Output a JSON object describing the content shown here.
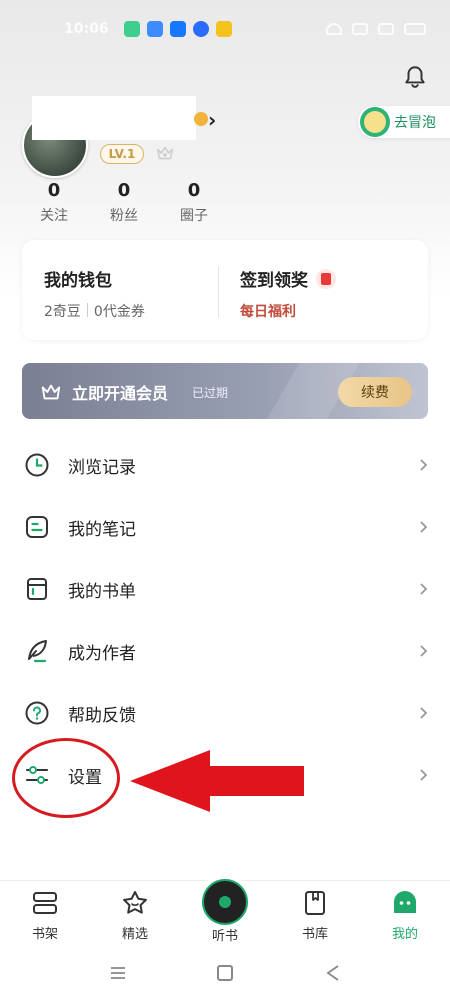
{
  "status_bar": {
    "time": "10:06",
    "app_icons": [
      {
        "name": "app-green-icon",
        "color": "#3ccf8e"
      },
      {
        "name": "app-baidu-icon",
        "color": "#3c8cff"
      },
      {
        "name": "app-alipay-icon",
        "color": "#1677ff"
      },
      {
        "name": "app-blue-dot-icon",
        "color": "#2b6cff"
      },
      {
        "name": "app-yellow-icon",
        "color": "#f4c21c"
      }
    ]
  },
  "profile": {
    "level": "LV.1",
    "stats": [
      {
        "value": "0",
        "label": "关注"
      },
      {
        "value": "0",
        "label": "粉丝"
      },
      {
        "value": "0",
        "label": "圈子"
      }
    ],
    "adventure_label": "去冒泡"
  },
  "wallet": {
    "title": "我的钱包",
    "beans": "2奇豆",
    "coupons": "0代金券",
    "checkin_title": "签到领奖",
    "daily_bonus": "每日福利"
  },
  "vip": {
    "title": "立即开通会员",
    "status": "已过期",
    "renew_label": "续费"
  },
  "menu": [
    {
      "icon": "history-icon",
      "label": "浏览记录"
    },
    {
      "icon": "notes-icon",
      "label": "我的笔记"
    },
    {
      "icon": "booklist-icon",
      "label": "我的书单"
    },
    {
      "icon": "quill-icon",
      "label": "成为作者"
    },
    {
      "icon": "help-icon",
      "label": "帮助反馈"
    },
    {
      "icon": "settings-icon",
      "label": "设置"
    }
  ],
  "tabs": [
    {
      "icon": "bookshelf-icon",
      "label": "书架",
      "active": false
    },
    {
      "icon": "featured-icon",
      "label": "精选",
      "active": false
    },
    {
      "icon": "listen-icon",
      "label": "听书",
      "active": false
    },
    {
      "icon": "library-icon",
      "label": "书库",
      "active": false
    },
    {
      "icon": "mine-icon",
      "label": "我的",
      "active": true
    }
  ],
  "colors": {
    "accent": "#1ea96b",
    "annotation": "#d71920"
  }
}
